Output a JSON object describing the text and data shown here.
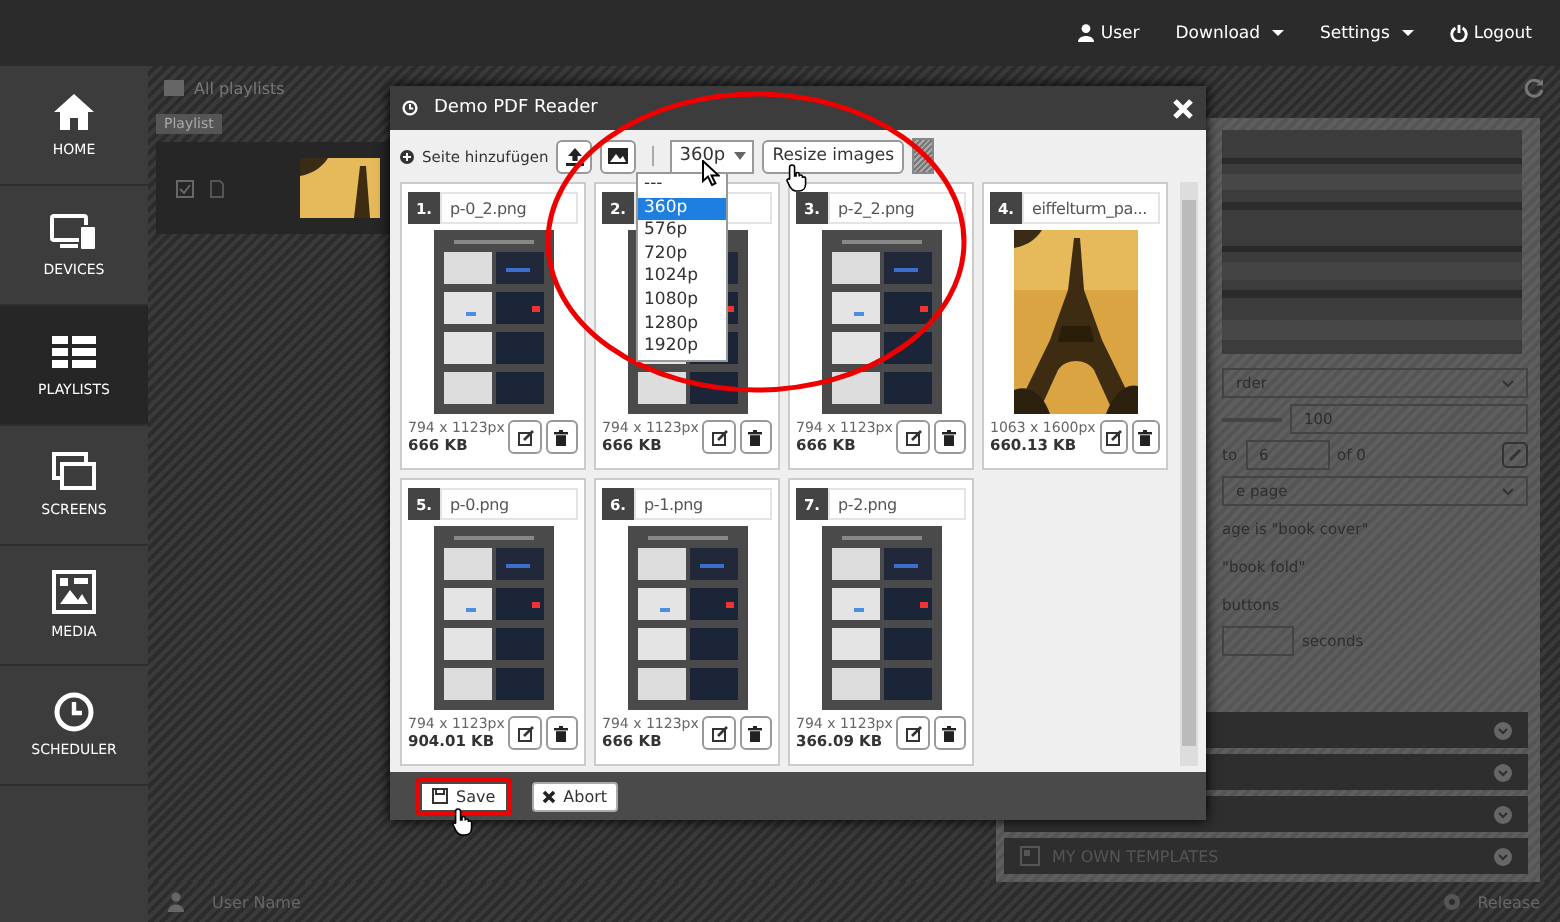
{
  "top_nav": [
    {
      "label": "User",
      "kind": "link"
    },
    {
      "label": "Download",
      "kind": "dropdown"
    },
    {
      "label": "Settings",
      "kind": "dropdown"
    },
    {
      "label": "Logout",
      "kind": "link"
    }
  ],
  "sidebar": {
    "items": [
      {
        "label": "HOME",
        "selected": false
      },
      {
        "label": "DEVICES",
        "selected": false
      },
      {
        "label": "PLAYLISTS",
        "selected": true
      },
      {
        "label": "SCREENS",
        "selected": false
      },
      {
        "label": "MEDIA",
        "selected": false
      },
      {
        "label": "SCHEDULER",
        "selected": false
      }
    ]
  },
  "main": {
    "breadcrumb": "All playlists",
    "playlist_tag": "Playlist",
    "settings": {
      "order_select": "rder",
      "slider_value": "100",
      "range_to": "to",
      "range_value": "6",
      "range_of": "of 0",
      "mode_select": "e page",
      "options": [
        "age is \"book cover\"",
        "\"book fold\"",
        "buttons"
      ],
      "duration_unit": "seconds"
    },
    "accordion": [
      {
        "expanded": false
      },
      {
        "expanded": false
      },
      {
        "expanded": false
      },
      {
        "label": "MY OWN TEMPLATES",
        "expanded": false
      }
    ],
    "status_bar": {
      "user": "User Name",
      "release": "Release"
    }
  },
  "modal": {
    "title": "Demo PDF Reader",
    "add_page_label": "Seite hinzufügen",
    "resolution": {
      "value": "360p",
      "expanded": true,
      "options": [
        {
          "label": "---",
          "selected": false
        },
        {
          "label": "360p",
          "selected": true
        },
        {
          "label": "576p",
          "selected": false
        },
        {
          "label": "720p",
          "selected": false
        },
        {
          "label": "1024p",
          "selected": false
        },
        {
          "label": "1080p",
          "selected": false
        },
        {
          "label": "1280p",
          "selected": false
        },
        {
          "label": "1920p",
          "selected": false
        }
      ]
    },
    "resize_button": "Resize images",
    "pages": [
      {
        "number": "1.",
        "name": "p-0_2.png",
        "dimensions": "794 x 1123px",
        "size": "666 KB",
        "kind": "document"
      },
      {
        "number": "2.",
        "dimensions": "794 x 1123px",
        "size": "666 KB",
        "kind": "document"
      },
      {
        "number": "3.",
        "name": "p-2_2.png",
        "dimensions": "794 x 1123px",
        "size": "666 KB",
        "kind": "document"
      },
      {
        "number": "4.",
        "name": "eiffelturm_pa...",
        "dimensions": "1063 x 1600px",
        "size": "660.13 KB"
      },
      {
        "number": "5.",
        "name": "p-0.png",
        "dimensions": "794 x 1123px",
        "size": "904.01 KB",
        "kind": "document"
      },
      {
        "number": "6.",
        "name": "p-1.png",
        "dimensions": "794 x 1123px",
        "size": "666 KB",
        "kind": "document"
      },
      {
        "number": "7.",
        "name": "p-2.png",
        "dimensions": "794 x 1123px",
        "size": "366.09 KB",
        "kind": "document"
      }
    ],
    "buttons": [
      {
        "label": "Save",
        "highlighted": true
      },
      {
        "label": "Abort",
        "highlighted": false
      }
    ]
  }
}
